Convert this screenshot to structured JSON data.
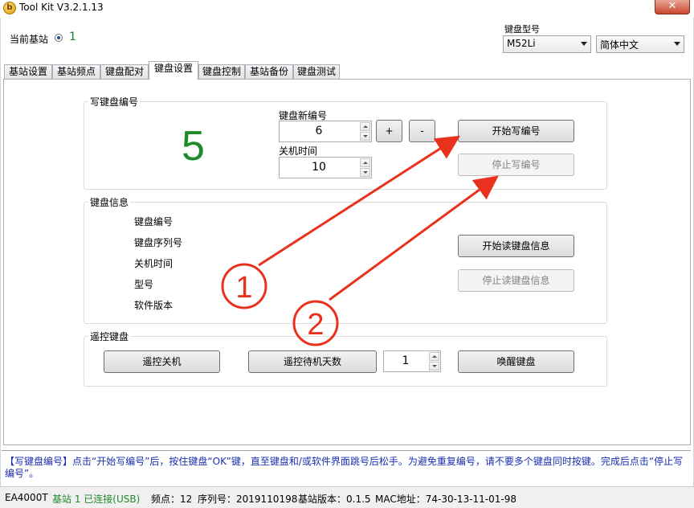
{
  "window": {
    "title": "Tool Kit  V3.2.1.13",
    "close_glyph": "✕",
    "app_icon_glyph": "b"
  },
  "header": {
    "station_label": "当前基站",
    "station_number": "1",
    "keyboard_model_label": "键盘型号",
    "keyboard_model_value": "M52Li",
    "language_value": "简体中文"
  },
  "tabs": [
    "基站设置",
    "基站频点",
    "键盘配对",
    "键盘设置",
    "键盘控制",
    "基站备份",
    "键盘测试"
  ],
  "active_tab": "键盘设置",
  "write_group": {
    "title": "写键盘编号",
    "current_number": "5",
    "new_number_label": "键盘新编号",
    "new_number_value": "6",
    "plus_label": "+",
    "minus_label": "-",
    "shutdown_time_label": "关机时间",
    "shutdown_time_value": "10",
    "start_button": "开始写编号",
    "stop_button": "停止写编号"
  },
  "info_group": {
    "title": "键盘信息",
    "fields": [
      "键盘编号",
      "键盘序列号",
      "关机时间",
      "型号",
      "软件版本"
    ],
    "start_button": "开始读键盘信息",
    "stop_button": "停止读键盘信息"
  },
  "remote_group": {
    "title": "遥控键盘",
    "shutdown_button": "遥控关机",
    "standby_days_button": "遥控待机天数",
    "standby_days_value": "1",
    "wake_button": "唤醒键盘"
  },
  "annotations": {
    "marker_1": "1",
    "marker_2": "2",
    "color": "#e8321e"
  },
  "help_text": "【写键盘编号】点击“开始写编号”后，按住键盘“OK”键，直至键盘和/或软件界面跳号后松手。为避免重复编号，请不要多个键盘同时按键。完成后点击“停止写编号”。",
  "status": {
    "device": "EA4000T",
    "connection": "基站 1 已连接(USB)",
    "frequency": "频点：12",
    "serial": "序列号：2019110198",
    "version": "基站版本：0.1.5",
    "mac": "MAC地址：74-30-13-11-01-98"
  }
}
